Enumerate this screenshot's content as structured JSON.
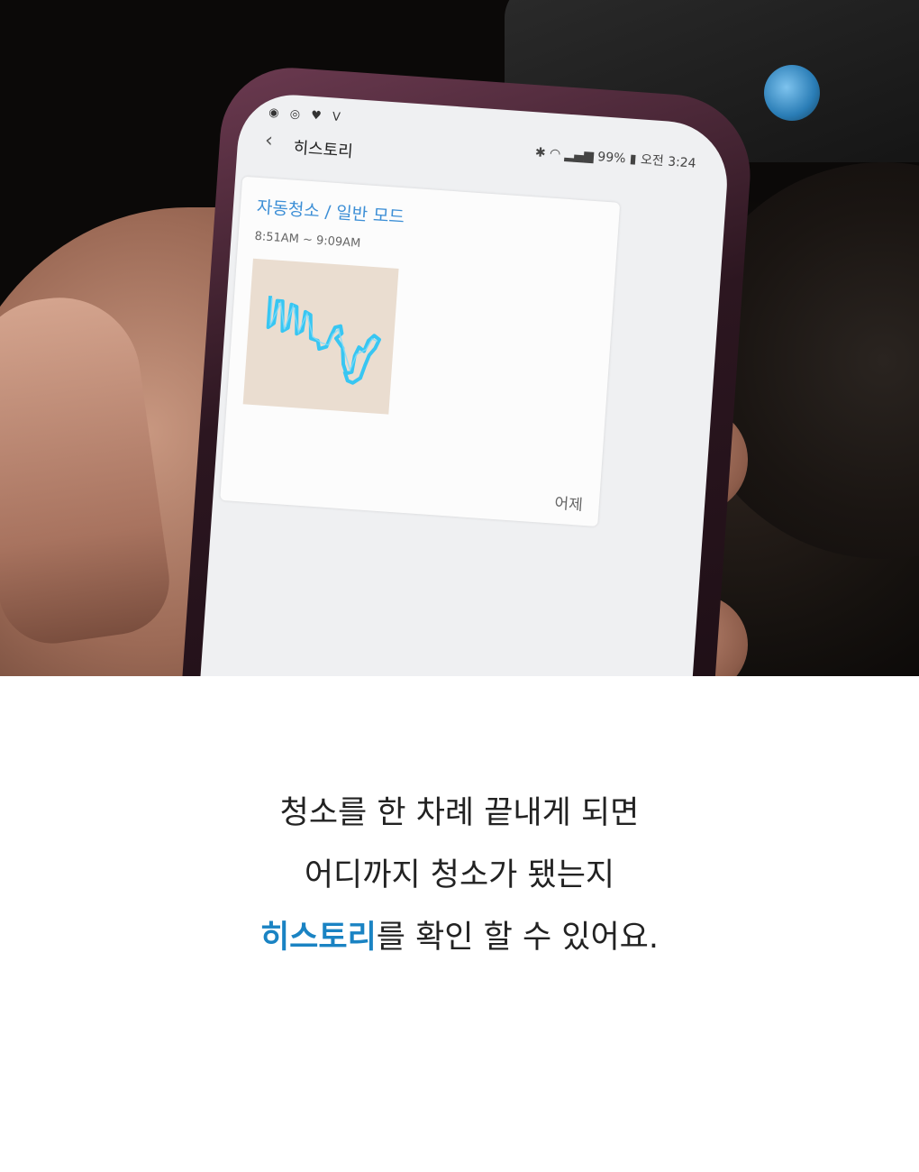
{
  "phone": {
    "status_bar": {
      "left_icons": [
        "clock-icon",
        "instagram-icon",
        "heart-icon",
        "app-icon"
      ],
      "right_icons": [
        "bluetooth-icon",
        "wifi-icon",
        "signal-icon",
        "battery-icon"
      ],
      "battery_label": "99%",
      "time_label": "오전 3:24"
    },
    "app_bar": {
      "back_icon": "chevron-left-icon",
      "title": "히스토리"
    },
    "history_card": {
      "mode_label": "자동청소 / 일반 모드",
      "time_range": "8:51AM ~ 9:09AM",
      "date_label": "어제",
      "map_colors": {
        "background": "#eaddd0",
        "path": "#38c6f2"
      }
    }
  },
  "caption": {
    "line1": "청소를 한 차례 끝내게 되면",
    "line2": "어디까지 청소가 됐는지",
    "line3_highlight": "히스토리",
    "line3_rest": "를 확인 할 수 있어요.",
    "highlight_color": "#1a83c3"
  }
}
